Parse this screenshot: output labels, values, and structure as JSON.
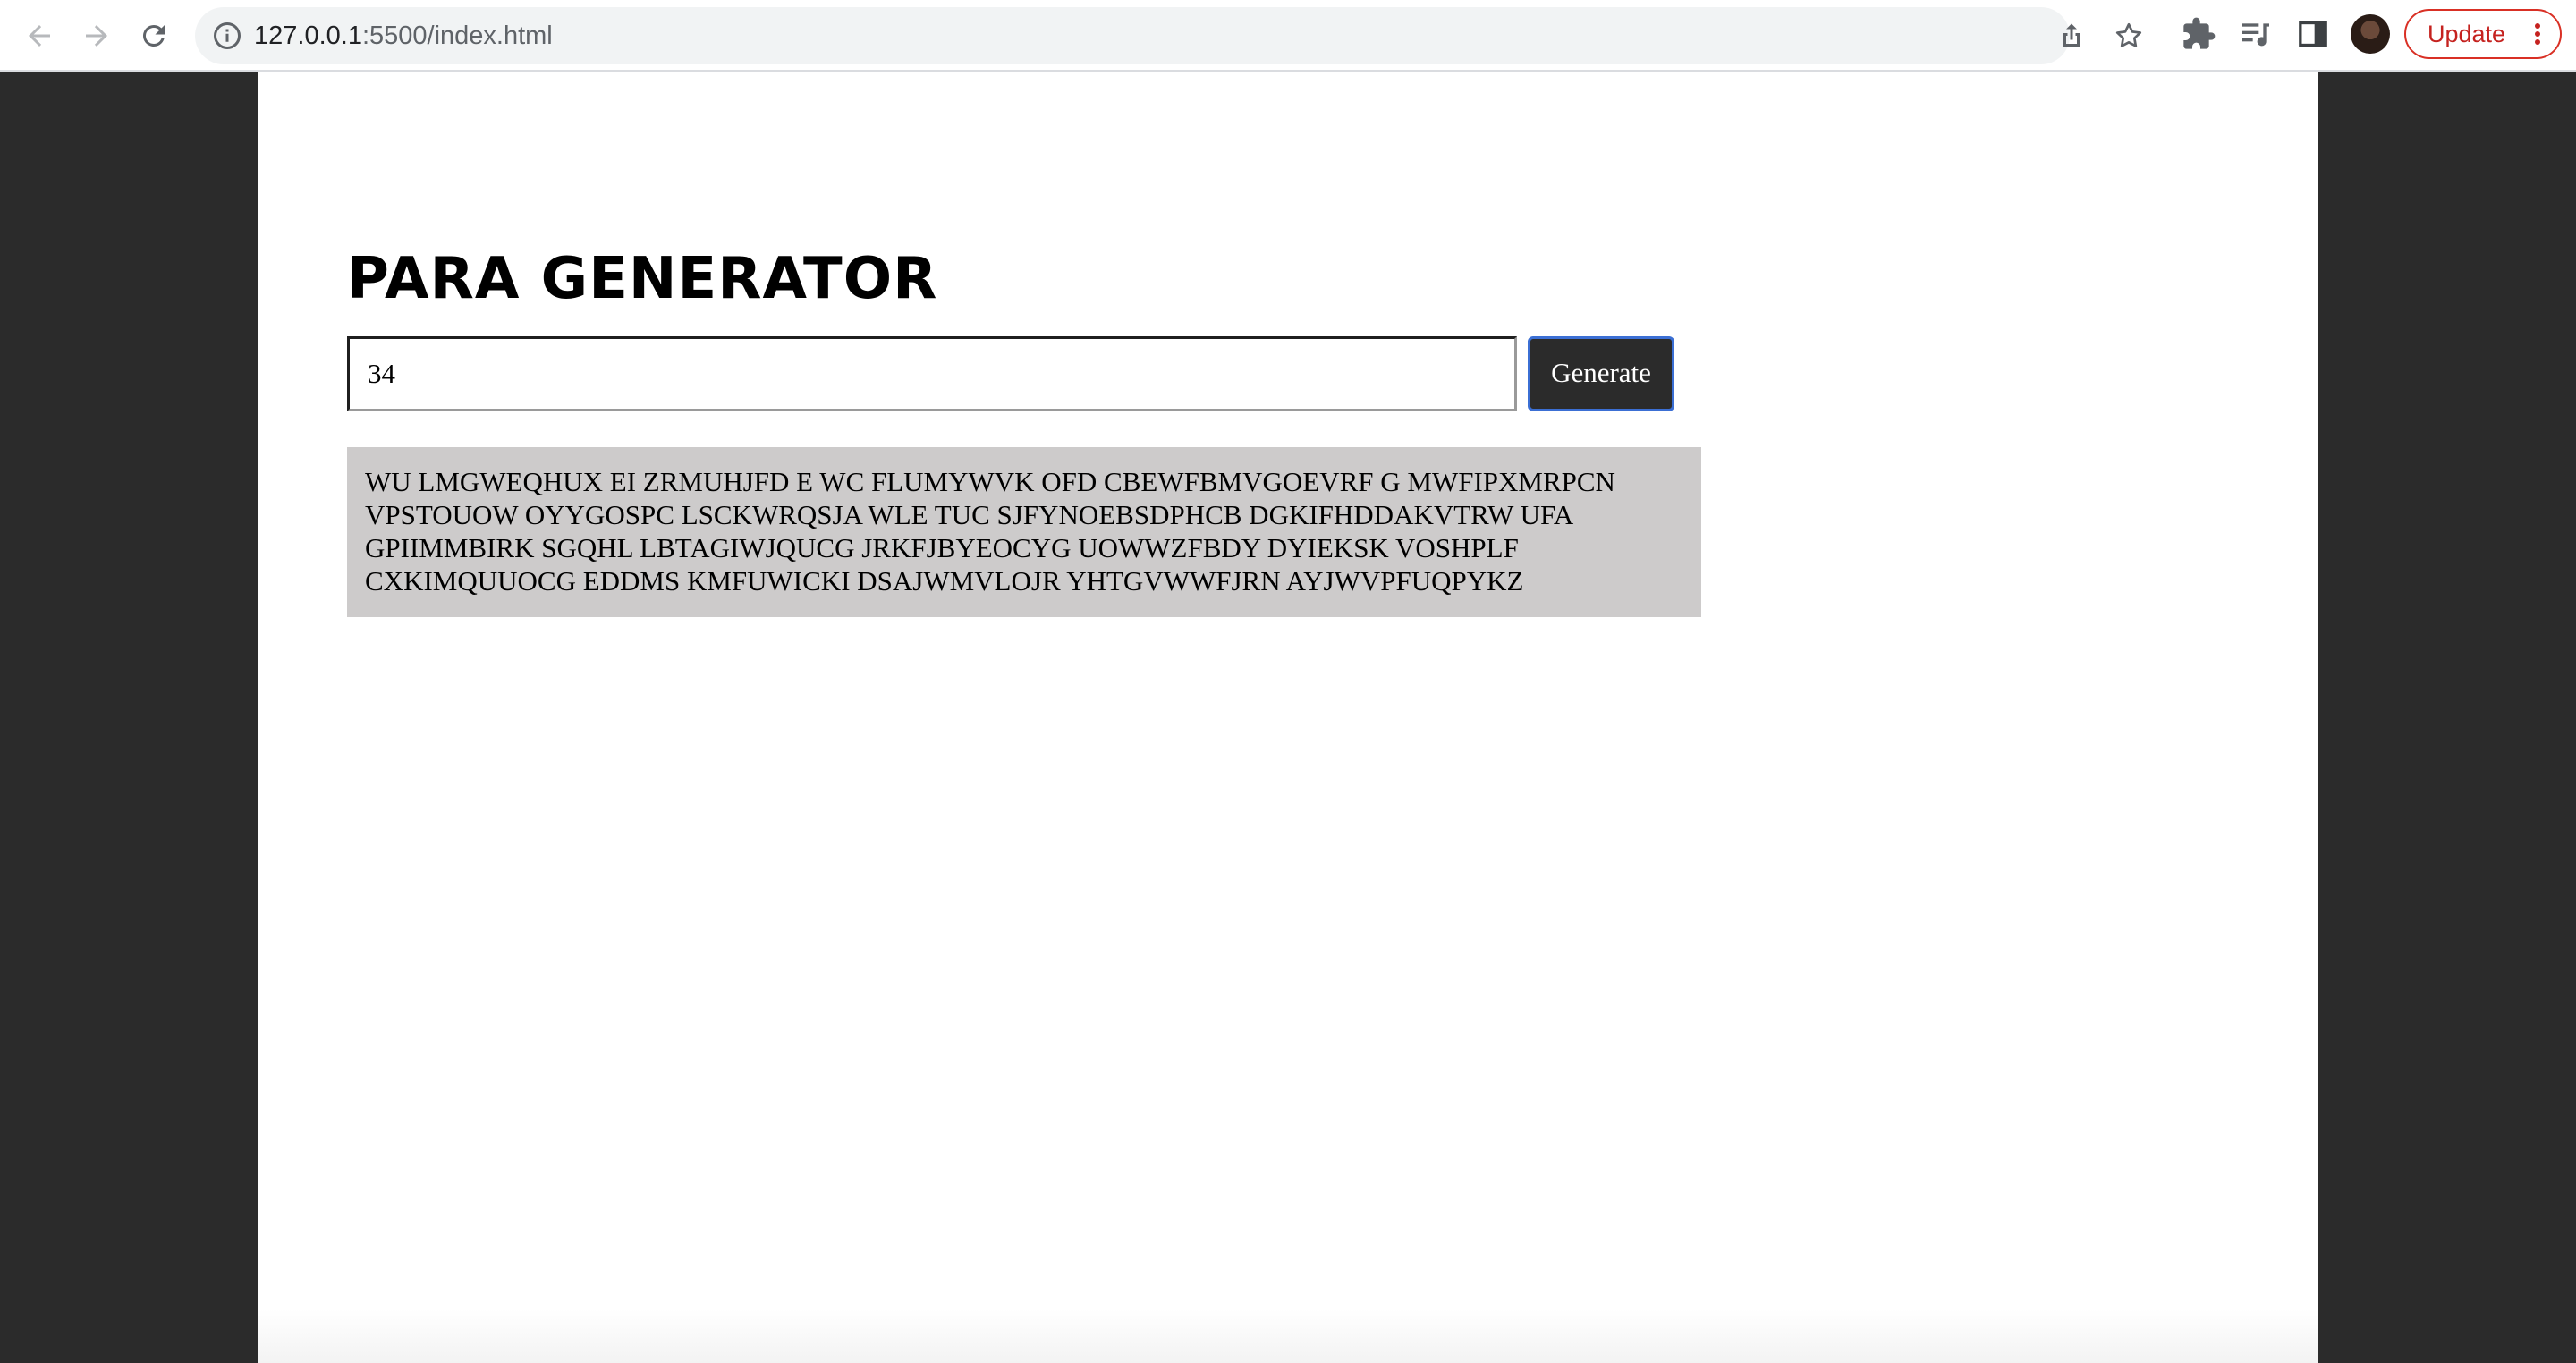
{
  "browser": {
    "url_host": "127.0.0.1",
    "url_rest": ":5500/index.html",
    "update_label": "Update"
  },
  "icons": {
    "back": "arrow-left-icon",
    "forward": "arrow-right-icon",
    "reload": "reload-icon",
    "info": "info-icon",
    "share": "share-icon",
    "bookmark": "star-icon",
    "extensions": "puzzle-icon",
    "reading_list": "reading-list-icon",
    "side_panel": "side-panel-icon",
    "profile": "avatar",
    "menu": "kebab-menu-icon"
  },
  "colors": {
    "page_background": "#ffffff",
    "outer_background": "#2b2b2b",
    "button_background": "#2b2b2b",
    "button_border_focus": "#3b6fd4",
    "output_background": "#cdcbcb",
    "update_red": "#c5221f"
  },
  "app": {
    "title": "PARA GENERATOR",
    "input_value": "34",
    "generate_label": "Generate",
    "output_lines": [
      "WU LMGWEQHUX EI ZRMUHJFD E WC FLUMYWVK OFD CBEWFBMVGOEVRF G MWFIPXMRPCN",
      "VPSTOUOW OYYGOSPC LSCKWRQSJA WLE TUC SJFYNOEBSDPHCB DGKIFHDDAKVTRW UFA",
      "GPIIMMBIRK SGQHL LBTAGIWJQUCG JRKFJBYEOCYG UOWWZFBDY DYIEKSK VOSHPLF",
      "CXKIMQUUOCG EDDMS KMFUWICKI DSAJWMVLOJR YHTGVWWFJRN AYJWVPFUQPYKZ"
    ]
  }
}
